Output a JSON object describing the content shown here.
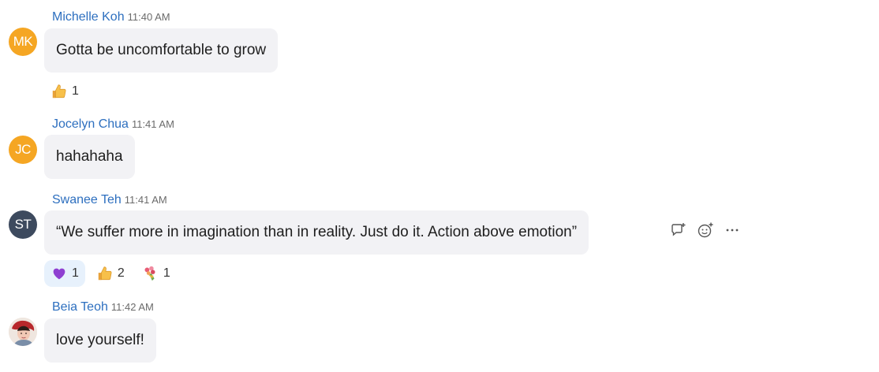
{
  "messages": [
    {
      "avatar_initials": "MK",
      "avatar_color": "#f5a623",
      "sender": "Michelle Koh",
      "time": "11:40 AM",
      "text": "Gotta be uncomfortable to grow",
      "reactions": [
        {
          "emoji": "thumbs-up-icon",
          "count": "1"
        }
      ]
    },
    {
      "avatar_initials": "JC",
      "avatar_color": "#f5a623",
      "sender": "Jocelyn Chua",
      "time": "11:41 AM",
      "text": "hahahaha"
    },
    {
      "avatar_initials": "ST",
      "avatar_color": "#3d4a5e",
      "sender": "Swanee Teh",
      "time": "11:41 AM",
      "text": "“We suffer more in imagination than in reality. Just do it. Action above emotion”",
      "reactions": [
        {
          "emoji": "purple-heart-icon",
          "count": "1"
        },
        {
          "emoji": "thumbs-up-icon",
          "count": "2"
        },
        {
          "emoji": "bouquet-icon",
          "count": "1"
        }
      ],
      "hover_actions": [
        "reply-icon",
        "add-reaction-icon",
        "more-options-icon"
      ]
    },
    {
      "avatar_photo": "profile-photo",
      "sender": "Beia Teoh",
      "time": "11:42 AM",
      "text": "love yourself!"
    }
  ],
  "colors": {
    "sender_name": "#2d6fbf",
    "bubble_bg": "#f2f2f5",
    "active_reaction_bg": "#e7f1fc"
  }
}
